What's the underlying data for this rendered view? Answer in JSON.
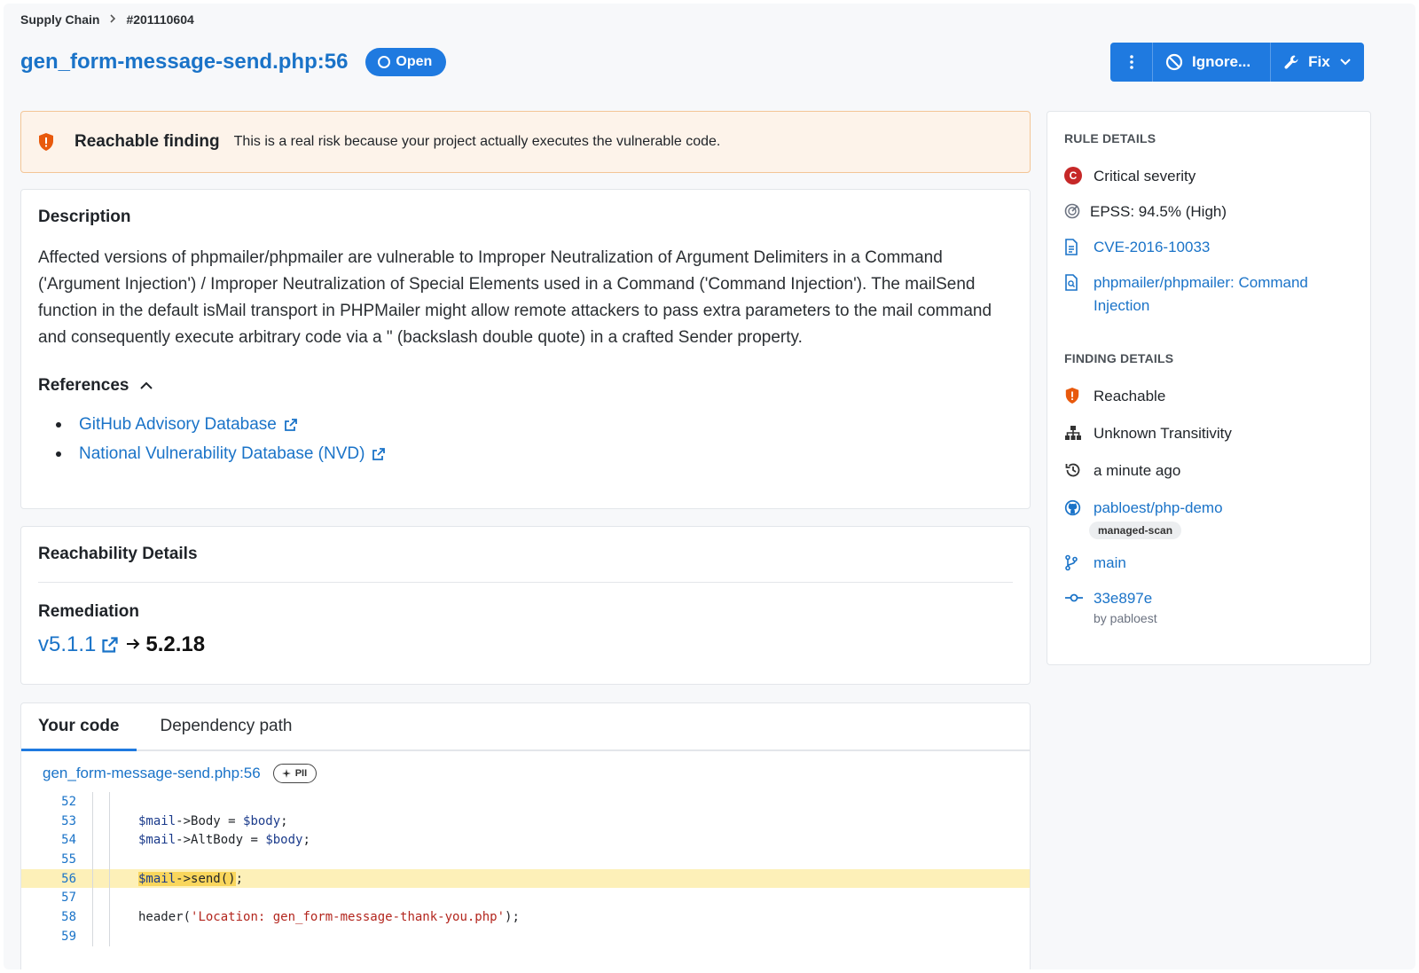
{
  "breadcrumb": {
    "root": "Supply Chain",
    "id": "#201110604"
  },
  "header": {
    "title": "gen_form-message-send.php:56",
    "status": "Open",
    "ignore_label": "Ignore...",
    "fix_label": "Fix"
  },
  "banner": {
    "title": "Reachable finding",
    "text": "This is a real risk because your project actually executes the vulnerable code."
  },
  "description": {
    "heading": "Description",
    "text": "Affected versions of phpmailer/phpmailer are vulnerable to Improper Neutralization of Argument Delimiters in a Command ('Argument Injection') / Improper Neutralization of Special Elements used in a Command ('Command Injection'). The mailSend function in the default isMail transport in PHPMailer might allow remote attackers to pass extra parameters to the mail command and consequently execute arbitrary code via a \" (backslash double quote) in a crafted Sender property.",
    "references_heading": "References",
    "references": [
      "GitHub Advisory Database",
      "National Vulnerability Database (NVD)"
    ]
  },
  "reachability": {
    "heading": "Reachability Details",
    "remediation_heading": "Remediation",
    "from_version": "v5.1.1",
    "to_version": "5.2.18"
  },
  "code": {
    "tabs": [
      "Your code",
      "Dependency path"
    ],
    "file": "gen_form-message-send.php:56",
    "pii": "PII",
    "lines": [
      {
        "n": "52",
        "code": ""
      },
      {
        "n": "53",
        "code": "$mail->Body = $body;"
      },
      {
        "n": "54",
        "code": "$mail->AltBody = $body;"
      },
      {
        "n": "55",
        "code": ""
      },
      {
        "n": "56",
        "code": "$mail->send();"
      },
      {
        "n": "57",
        "code": ""
      },
      {
        "n": "58",
        "code": "header('Location: gen_form-message-thank-you.php');"
      },
      {
        "n": "59",
        "code": ""
      }
    ]
  },
  "rule_details": {
    "heading": "RULE DETAILS",
    "severity": "Critical severity",
    "severity_letter": "C",
    "epss": "EPSS: 94.5% (High)",
    "cve": "CVE-2016-10033",
    "advisory": "phpmailer/phpmailer: Command Injection"
  },
  "finding_details": {
    "heading": "FINDING DETAILS",
    "reachable": "Reachable",
    "transitivity": "Unknown Transitivity",
    "time": "a minute ago",
    "repo": "pabloest/php-demo",
    "repo_tag": "managed-scan",
    "branch": "main",
    "commit": "33e897e",
    "commit_author": "by pabloest"
  },
  "colors": {
    "accent": "#1f7ae0",
    "link": "#1a73c8",
    "critical": "#c62828",
    "warning": "#e8590c",
    "banner_bg": "#fdf3ea",
    "highlight": "#fdf0b8"
  }
}
